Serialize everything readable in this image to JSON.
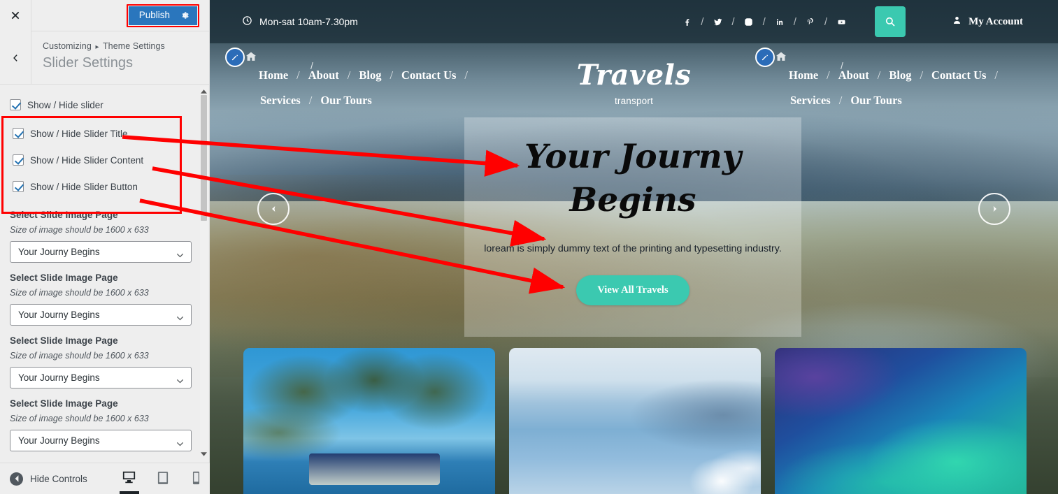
{
  "customizer": {
    "close_icon": "close-icon",
    "publish_label": "Publish",
    "gear_icon": "gear-icon",
    "back_icon": "chevron-left-icon",
    "breadcrumb_root": "Customizing",
    "breadcrumb_sep": "▸",
    "breadcrumb_section": "Theme Settings",
    "panel_title": "Slider Settings",
    "checkboxes": [
      {
        "label": "Show / Hide slider",
        "checked": true
      },
      {
        "label": "Show / Hide Slider Title",
        "checked": true
      },
      {
        "label": "Show / Hide Slider Content",
        "checked": true
      },
      {
        "label": "Show / Hide Slider Button",
        "checked": true
      }
    ],
    "slide_fields": [
      {
        "label": "Select Slide Image Page",
        "hint": "Size of image should be 1600 x 633",
        "value": "Your Journy Begins"
      },
      {
        "label": "Select Slide Image Page",
        "hint": "Size of image should be 1600 x 633",
        "value": "Your Journy Begins"
      },
      {
        "label": "Select Slide Image Page",
        "hint": "Size of image should be 1600 x 633",
        "value": "Your Journy Begins"
      },
      {
        "label": "Select Slide Image Page",
        "hint": "Size of image should be 1600 x 633",
        "value": "Your Journy Begins"
      }
    ],
    "footer": {
      "hide_controls_label": "Hide Controls",
      "devices": [
        "desktop-preview-icon",
        "tablet-preview-icon",
        "mobile-preview-icon"
      ],
      "active_device": "desktop-preview-icon"
    },
    "highlight_color": "#ff0000",
    "publish_color": "#2a76bd"
  },
  "preview": {
    "topbar": {
      "hours": "Mon-sat 10am-7.30pm",
      "clock_icon": "clock-icon",
      "social": [
        "facebook-icon",
        "twitter-icon",
        "instagram-icon",
        "linkedin-icon",
        "pinterest-icon",
        "youtube-icon"
      ],
      "social_separator": "/",
      "search_icon": "search-icon",
      "search_bg": "#3bc9b0",
      "account_label": "My Account",
      "account_icon": "user-icon"
    },
    "nav": {
      "edit_icon": "edit-pencil-icon",
      "home_icon": "home-icon",
      "separator": "/",
      "row1": [
        "Home",
        "About",
        "Blog",
        "Contact Us"
      ],
      "row2": [
        "Services",
        "Our Tours"
      ]
    },
    "brand": {
      "name": "Travels",
      "tagline": "transport"
    },
    "hero": {
      "title_line1": "Your Journy",
      "title_line2": "Begins",
      "description": "loream is simply dummy text of the printing and typesetting industry.",
      "button_label": "View All Travels",
      "button_color": "#3bc9b0",
      "prev_icon": "chevron-left-icon",
      "next_icon": "chevron-right-icon"
    },
    "cards": [
      {
        "name": "palm-beach-card"
      },
      {
        "name": "santorini-coast-card"
      },
      {
        "name": "aurora-card"
      }
    ]
  },
  "annotations": {
    "arrow_color": "#ff0000",
    "arrows": [
      {
        "from": "Show / Hide Slider Title",
        "to": "hero title"
      },
      {
        "from": "Show / Hide Slider Content",
        "to": "hero description"
      },
      {
        "from": "Show / Hide Slider Button",
        "to": "hero button"
      }
    ]
  }
}
